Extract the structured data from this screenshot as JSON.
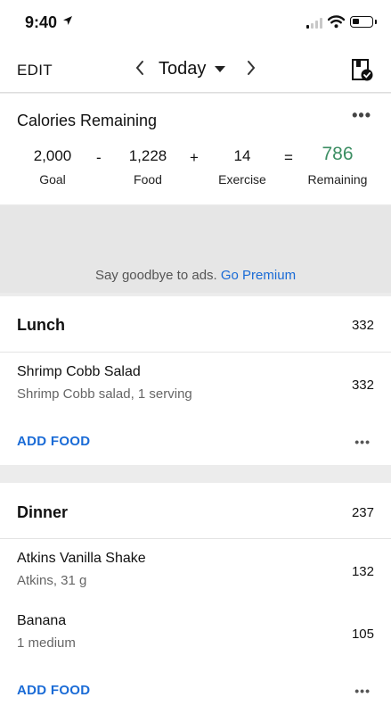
{
  "status_bar": {
    "time": "9:40",
    "location_icon": "location-arrow-icon",
    "signal": "signal-icon",
    "wifi": "wifi-icon",
    "battery": "battery-icon"
  },
  "nav": {
    "edit_label": "EDIT",
    "prev_icon": "chevron-left-icon",
    "date_label": "Today",
    "dropdown_icon": "caret-down-icon",
    "next_icon": "chevron-right-icon",
    "diary_icon": "diary-complete-icon"
  },
  "calories": {
    "title": "Calories Remaining",
    "goal": {
      "value": "2,000",
      "label": "Goal"
    },
    "op_minus": "-",
    "food": {
      "value": "1,228",
      "label": "Food"
    },
    "op_plus": "+",
    "exercise": {
      "value": "14",
      "label": "Exercise"
    },
    "op_equals": "=",
    "remaining": {
      "value": "786",
      "label": "Remaining"
    },
    "more_label": "•••",
    "accent_color": "#3c8e63"
  },
  "ad": {
    "text": "Say goodbye to ads.",
    "link": "Go Premium",
    "link_color": "#1a6bd6"
  },
  "meals": [
    {
      "name": "Lunch",
      "total": "332",
      "items": [
        {
          "name": "Shrimp Cobb Salad",
          "desc": "Shrimp Cobb salad, 1 serving",
          "cal": "332"
        }
      ],
      "add_label": "ADD FOOD",
      "more_label": "•••"
    },
    {
      "name": "Dinner",
      "total": "237",
      "items": [
        {
          "name": "Atkins Vanilla Shake",
          "desc": "Atkins, 31 g",
          "cal": "132"
        },
        {
          "name": "Banana",
          "desc": "1 medium",
          "cal": "105"
        }
      ],
      "add_label": "ADD FOOD",
      "more_label": "•••"
    }
  ]
}
